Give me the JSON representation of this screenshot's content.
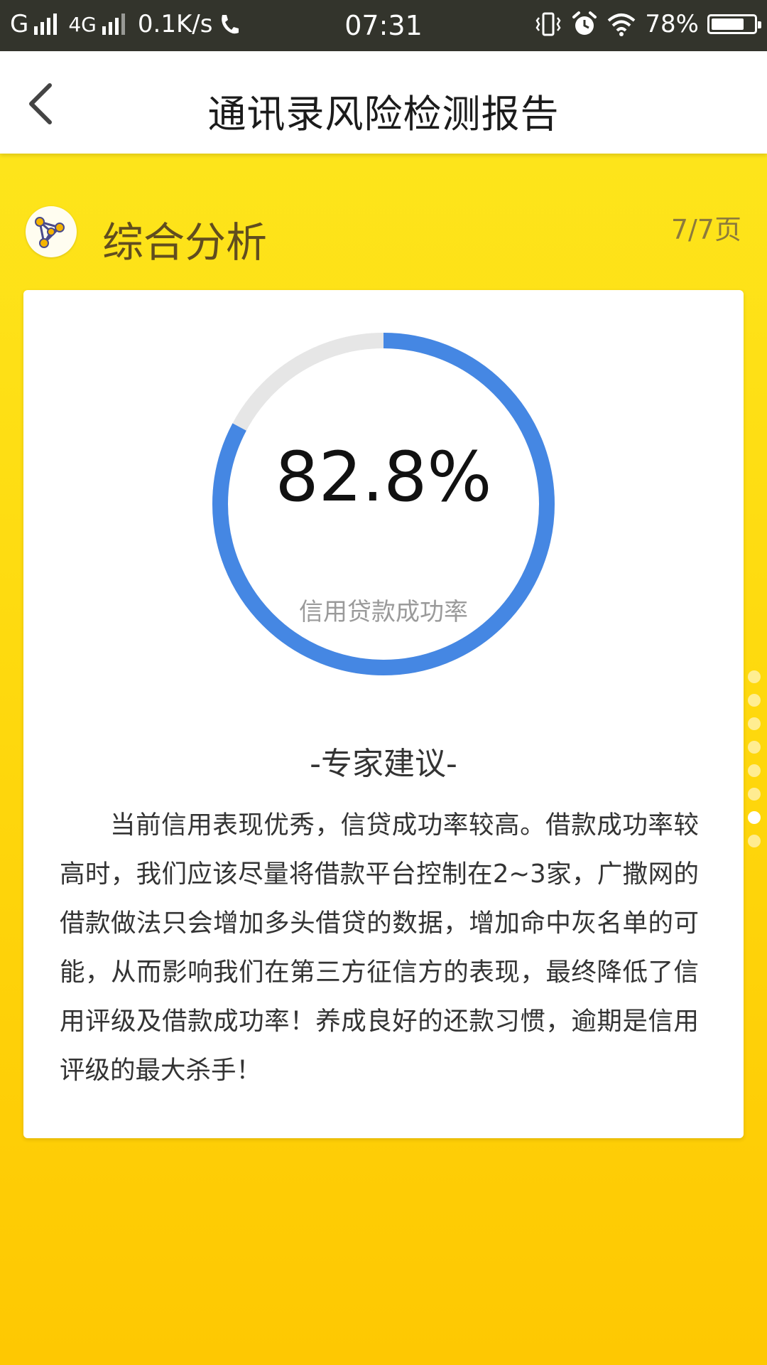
{
  "status_bar": {
    "carrier": "G",
    "network": "4G",
    "speed": "0.1K/s",
    "time": "07:31",
    "battery": "78%",
    "battery_level": 0.78,
    "icons": [
      "signal-icon",
      "call-icon",
      "vibrate-icon",
      "alarm-icon",
      "wifi-icon",
      "battery-icon"
    ]
  },
  "app_bar": {
    "title": "通讯录风险检测报告",
    "back_icon": "chevron-left-icon"
  },
  "section": {
    "title": "综合分析",
    "page": "7/7页",
    "icon": "network-graph-icon"
  },
  "gauge": {
    "value": "82.8%",
    "fraction": 0.828,
    "label": "信用贷款成功率",
    "colors": {
      "progress": "#4587e3",
      "track": "#e6e6e6"
    }
  },
  "advice": {
    "title": "-专家建议-",
    "text": "当前信用表现优秀，信贷成功率较高。借款成功率较高时，我们应该尽量将借款平台控制在2~3家，广撒网的借款做法只会增加多头借贷的数据，增加命中灰名单的可能，从而影响我们在第三方征信方的表现，最终降低了信用评级及借款成功率！养成良好的还款习惯，逾期是信用评级的最大杀手！"
  },
  "pager": {
    "count": 8,
    "active": 7
  },
  "colors": {
    "background_top": "#fde81f",
    "background_bottom": "#fec802",
    "status_bar": "#33342c",
    "section_title": "#614d1f"
  }
}
